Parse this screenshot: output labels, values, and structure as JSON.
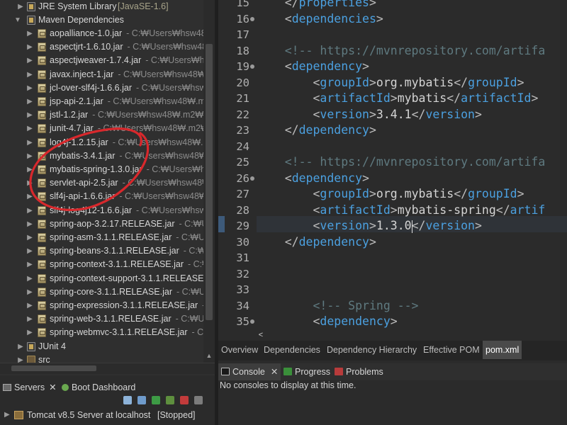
{
  "tree": {
    "jre": {
      "label": "JRE System Library",
      "qualifier": "[JavaSE-1.6]"
    },
    "maven": {
      "label": "Maven Dependencies"
    },
    "jars": [
      {
        "name": "aopalliance-1.0.jar",
        "path": "C:₩Users₩hsw48₩.m"
      },
      {
        "name": "aspectjrt-1.6.10.jar",
        "path": "C:₩Users₩hsw48₩"
      },
      {
        "name": "aspectjweaver-1.7.4.jar",
        "path": "C:₩Users₩hsv"
      },
      {
        "name": "javax.inject-1.jar",
        "path": "C:₩Users₩hsw48₩.m"
      },
      {
        "name": "jcl-over-slf4j-1.6.6.jar",
        "path": "C:₩Users₩hsw4"
      },
      {
        "name": "jsp-api-2.1.jar",
        "path": "C:₩Users₩hsw48₩.m2"
      },
      {
        "name": "jstl-1.2.jar",
        "path": "C:₩Users₩hsw48₩.m2₩rep"
      },
      {
        "name": "junit-4.7.jar",
        "path": "C:₩Users₩hsw48₩.m2₩re"
      },
      {
        "name": "log4j-1.2.15.jar",
        "path": "C:₩Users₩hsw48₩.m2"
      },
      {
        "name": "mybatis-3.4.1.jar",
        "path": "C:₩Users₩hsw48₩.m"
      },
      {
        "name": "mybatis-spring-1.3.0.jar",
        "path": "C:₩Users₩hs"
      },
      {
        "name": "servlet-api-2.5.jar",
        "path": "C:₩Users₩hsw48₩"
      },
      {
        "name": "slf4j-api-1.6.6.jar",
        "path": "C:₩Users₩hsw48₩.r"
      },
      {
        "name": "slf4j-log4j12-1.6.6.jar",
        "path": "C:₩Users₩hsw"
      },
      {
        "name": "spring-aop-3.2.17.RELEASE.jar",
        "path": "C:₩Use"
      },
      {
        "name": "spring-asm-3.1.1.RELEASE.jar",
        "path": "C:₩Use"
      },
      {
        "name": "spring-beans-3.1.1.RELEASE.jar",
        "path": "C:₩Us"
      },
      {
        "name": "spring-context-3.1.1.RELEASE.jar",
        "path": "C:₩U"
      },
      {
        "name": "spring-context-support-3.1.1.RELEASE.j",
        "path": ""
      },
      {
        "name": "spring-core-3.1.1.RELEASE.jar",
        "path": "C:₩Use"
      },
      {
        "name": "spring-expression-3.1.1.RELEASE.jar",
        "path": "C:₩"
      },
      {
        "name": "spring-web-3.1.1.RELEASE.jar",
        "path": "C:₩Use"
      },
      {
        "name": "spring-webmvc-3.1.1.RELEASE.jar",
        "path": "C:₩U"
      }
    ],
    "junit": {
      "label": "JUnit 4"
    },
    "src": {
      "label": "src"
    }
  },
  "editor": {
    "lines": [
      {
        "n": "15",
        "fold": false,
        "code": [
          [
            "    ",
            "tx"
          ],
          [
            "</",
            "br"
          ],
          [
            "properties",
            "tg"
          ],
          [
            ">",
            "br"
          ]
        ]
      },
      {
        "n": "16",
        "fold": true,
        "code": [
          [
            "    ",
            "tx"
          ],
          [
            "<",
            "br"
          ],
          [
            "dependencies",
            "tg"
          ],
          [
            ">",
            "br"
          ]
        ]
      },
      {
        "n": "17",
        "fold": false,
        "code": []
      },
      {
        "n": "18",
        "fold": false,
        "code": [
          [
            "    ",
            "tx"
          ],
          [
            "<!-- https://mvnrepository.com/artifa",
            "cm"
          ]
        ]
      },
      {
        "n": "19",
        "fold": true,
        "code": [
          [
            "    ",
            "tx"
          ],
          [
            "<",
            "br"
          ],
          [
            "dependency",
            "tg"
          ],
          [
            ">",
            "br"
          ]
        ]
      },
      {
        "n": "20",
        "fold": false,
        "code": [
          [
            "        ",
            "tx"
          ],
          [
            "<",
            "br"
          ],
          [
            "groupId",
            "tg"
          ],
          [
            ">",
            "br"
          ],
          [
            "org.mybatis",
            "tx"
          ],
          [
            "</",
            "br"
          ],
          [
            "groupId",
            "tg"
          ],
          [
            ">",
            "br"
          ]
        ]
      },
      {
        "n": "21",
        "fold": false,
        "code": [
          [
            "        ",
            "tx"
          ],
          [
            "<",
            "br"
          ],
          [
            "artifactId",
            "tg"
          ],
          [
            ">",
            "br"
          ],
          [
            "mybatis",
            "tx"
          ],
          [
            "</",
            "br"
          ],
          [
            "artifactId",
            "tg"
          ],
          [
            ">",
            "br"
          ]
        ]
      },
      {
        "n": "22",
        "fold": false,
        "code": [
          [
            "        ",
            "tx"
          ],
          [
            "<",
            "br"
          ],
          [
            "version",
            "tg"
          ],
          [
            ">",
            "br"
          ],
          [
            "3.4.1",
            "tx"
          ],
          [
            "</",
            "br"
          ],
          [
            "version",
            "tg"
          ],
          [
            ">",
            "br"
          ]
        ]
      },
      {
        "n": "23",
        "fold": false,
        "code": [
          [
            "    ",
            "tx"
          ],
          [
            "</",
            "br"
          ],
          [
            "dependency",
            "tg"
          ],
          [
            ">",
            "br"
          ]
        ]
      },
      {
        "n": "24",
        "fold": false,
        "code": []
      },
      {
        "n": "25",
        "fold": false,
        "code": [
          [
            "    ",
            "tx"
          ],
          [
            "<!-- https://mvnrepository.com/artifa",
            "cm"
          ]
        ]
      },
      {
        "n": "26",
        "fold": true,
        "code": [
          [
            "    ",
            "tx"
          ],
          [
            "<",
            "br"
          ],
          [
            "dependency",
            "tg"
          ],
          [
            ">",
            "br"
          ]
        ]
      },
      {
        "n": "27",
        "fold": false,
        "code": [
          [
            "        ",
            "tx"
          ],
          [
            "<",
            "br"
          ],
          [
            "groupId",
            "tg"
          ],
          [
            ">",
            "br"
          ],
          [
            "org.mybatis",
            "tx"
          ],
          [
            "</",
            "br"
          ],
          [
            "groupId",
            "tg"
          ],
          [
            ">",
            "br"
          ]
        ]
      },
      {
        "n": "28",
        "fold": false,
        "code": [
          [
            "        ",
            "tx"
          ],
          [
            "<",
            "br"
          ],
          [
            "artifactId",
            "tg"
          ],
          [
            ">",
            "br"
          ],
          [
            "mybatis-spring",
            "tx"
          ],
          [
            "</",
            "br"
          ],
          [
            "artif",
            "tg"
          ]
        ]
      },
      {
        "n": "29",
        "fold": false,
        "code": [
          [
            "        ",
            "tx"
          ],
          [
            "<",
            "br"
          ],
          [
            "version",
            "tg"
          ],
          [
            ">",
            "br"
          ],
          [
            "1.3.0",
            "tx"
          ],
          [
            "</",
            "br"
          ],
          [
            "version",
            "tg"
          ],
          [
            ">",
            "br"
          ]
        ]
      },
      {
        "n": "30",
        "fold": false,
        "code": [
          [
            "    ",
            "tx"
          ],
          [
            "</",
            "br"
          ],
          [
            "dependency",
            "tg"
          ],
          [
            ">",
            "br"
          ]
        ]
      },
      {
        "n": "31",
        "fold": false,
        "code": []
      },
      {
        "n": "32",
        "fold": false,
        "code": []
      },
      {
        "n": "33",
        "fold": false,
        "code": []
      },
      {
        "n": "34",
        "fold": false,
        "code": [
          [
            "        ",
            "tx"
          ],
          [
            "<!-- Spring -->",
            "cm"
          ]
        ]
      },
      {
        "n": "35",
        "fold": true,
        "code": [
          [
            "        ",
            "tx"
          ],
          [
            "<",
            "br"
          ],
          [
            "dependency",
            "tg"
          ],
          [
            ">",
            "br"
          ]
        ]
      }
    ],
    "tabs": [
      "Overview",
      "Dependencies",
      "Dependency Hierarchy",
      "Effective POM",
      "pom.xml"
    ],
    "active_tab": "pom.xml"
  },
  "console": {
    "tabs": [
      "Console",
      "Progress",
      "Problems"
    ],
    "message": "No consoles to display at this time."
  },
  "servers": {
    "tabs": [
      "Servers",
      "Boot Dashboard"
    ],
    "row": "Tomcat v8.5 Server at localhost",
    "status": "[Stopped]"
  },
  "colors": {
    "tag": "#4ba0e0",
    "comment": "#5f7a80",
    "annotation": "#d8282c"
  }
}
